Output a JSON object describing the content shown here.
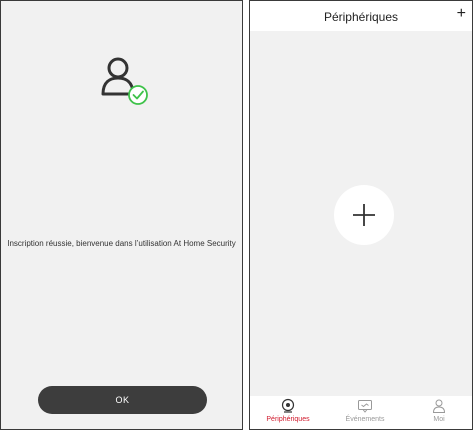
{
  "left_screen": {
    "message": "Inscription réussie, bienvenue dans l’utilisation At Home Security",
    "ok_label": "OK"
  },
  "right_screen": {
    "title": "Périphériques",
    "add_symbol": "+",
    "tabs": [
      {
        "label": "Périphériques",
        "icon": "camera-icon",
        "active": true
      },
      {
        "label": "Événements",
        "icon": "message-icon",
        "active": false
      },
      {
        "label": "Moi",
        "icon": "user-icon",
        "active": false
      }
    ]
  },
  "colors": {
    "accent": "#d0192c",
    "success": "#3ec24a",
    "button": "#3d3d3d",
    "background": "#f1f1f1"
  }
}
